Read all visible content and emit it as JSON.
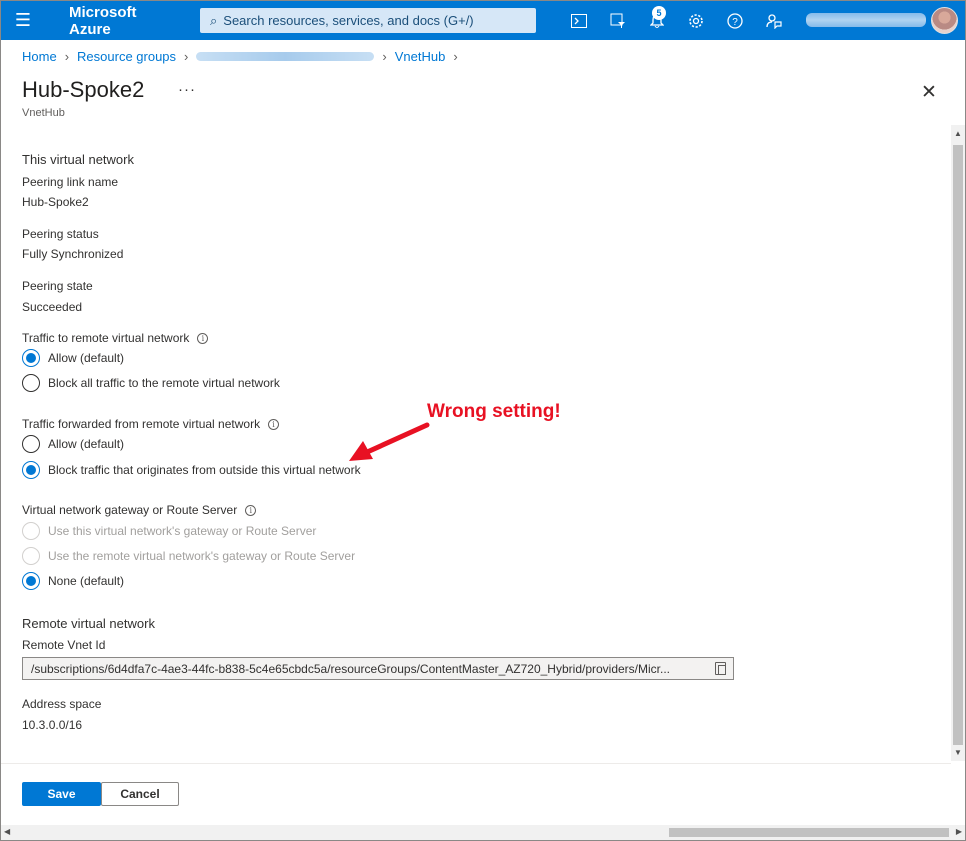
{
  "topbar": {
    "menu_icon": "hamburger-icon",
    "brand": "Microsoft Azure",
    "search_placeholder": "Search resources, services, and docs (G+/)",
    "icons": [
      "cloud-shell-icon",
      "directory-filter-icon",
      "notifications-icon",
      "settings-icon",
      "help-icon",
      "feedback-icon"
    ],
    "notification_count": "5"
  },
  "breadcrumb": {
    "home": "Home",
    "resource_groups": "Resource groups",
    "vnet": "VnetHub"
  },
  "header": {
    "title": "Hub-Spoke2",
    "more": "···",
    "subtitle": "VnetHub",
    "close": "✕"
  },
  "this_network": {
    "heading": "This virtual network",
    "link_name_label": "Peering link name",
    "link_name_value": "Hub-Spoke2",
    "status_label": "Peering status",
    "status_value": "Fully Synchronized",
    "state_label": "Peering state",
    "state_value": "Succeeded"
  },
  "traffic_to_remote": {
    "label": "Traffic to remote virtual network",
    "options": [
      "Allow (default)",
      "Block all traffic to the remote virtual network"
    ],
    "selected": 0
  },
  "traffic_forwarded": {
    "label": "Traffic forwarded from remote virtual network",
    "options": [
      "Allow (default)",
      "Block traffic that originates from outside this virtual network"
    ],
    "selected": 1
  },
  "gateway": {
    "label": "Virtual network gateway or Route Server",
    "options": [
      "Use this virtual network's gateway or Route Server",
      "Use the remote virtual network's gateway or Route Server",
      "None (default)"
    ],
    "selected": 2
  },
  "remote": {
    "heading": "Remote virtual network",
    "vnet_id_label": "Remote Vnet Id",
    "vnet_id_value": "/subscriptions/6d4dfa7c-4ae3-44fc-b838-5c4e65cbdc5a/resourceGroups/ContentMaster_AZ720_Hybrid/providers/Micr...",
    "address_label": "Address space",
    "address_value": "10.3.0.0/16"
  },
  "annotation": {
    "text": "Wrong setting!",
    "color": "#e81123"
  },
  "footer": {
    "save": "Save",
    "cancel": "Cancel"
  },
  "colors": {
    "accent": "#0078d4"
  }
}
